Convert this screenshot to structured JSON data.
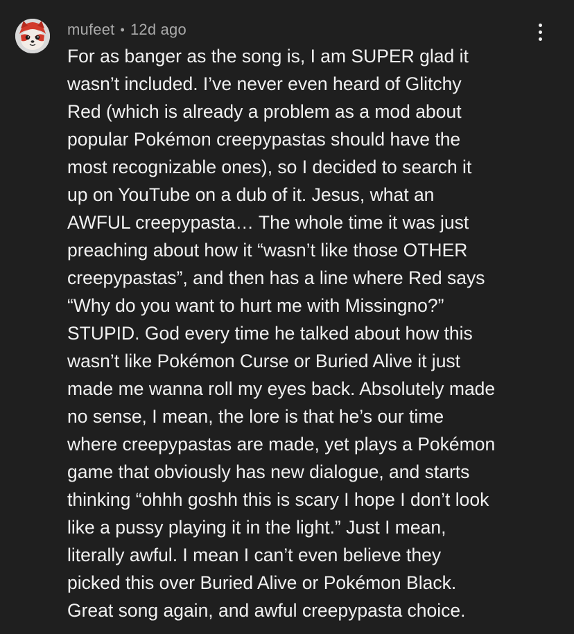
{
  "comment": {
    "author": "mufeet",
    "separator": "•",
    "timestamp": "12d ago",
    "avatar_icon": "fox-avatar-icon",
    "menu_icon": "more-vertical-icon",
    "lines": [
      "For as banger as the song is, I am SUPER glad it",
      "wasn’t included. I’ve never even heard of Glitchy",
      "Red (which is already a problem as a mod about",
      "popular Pokémon creepypastas should have the",
      "most recognizable ones), so I decided to search it",
      "up on YouTube on a dub of it. Jesus, what an",
      "AWFUL creepypasta… The whole time it was just",
      "preaching about how it “wasn’t like those OTHER",
      "creepypastas”, and then has a line where Red says",
      "“Why do you want to hurt me with Missingno?”",
      "STUPID. God every time he talked about how this",
      "wasn’t like Pokémon Curse or Buried Alive it just",
      "made me wanna roll my eyes back. Absolutely made",
      "no sense, I mean, the lore is that he’s our time",
      "where creepypastas are made, yet plays a Pokémon",
      "game that obviously has new dialogue, and starts",
      "thinking “ohhh goshh this is scary I hope I don’t look",
      "like a pussy playing it in the light.” Just I mean,",
      "literally awful. I mean I can’t even believe they",
      "picked this over Buried Alive or Pokémon Black.",
      "Great song again, and awful creepypasta choice."
    ]
  },
  "colors": {
    "background": "#1f1f1f",
    "text_primary": "#f1f1f1",
    "text_secondary": "#aaaaaa"
  }
}
